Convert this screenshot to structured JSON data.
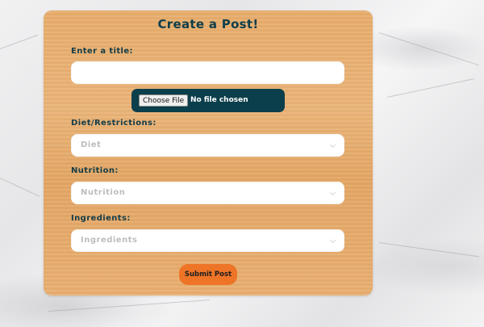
{
  "form": {
    "heading": "Create a Post!",
    "title_label": "Enter a title:",
    "title_value": "",
    "file_input": {
      "button_label": "Choose File",
      "status_text": "No file chosen"
    },
    "diet": {
      "label": "Diet/Restrictions:",
      "selected": "Diet"
    },
    "nutrition": {
      "label": "Nutrition:",
      "selected": "Nutrition"
    },
    "ingredients": {
      "label": "Ingredients:",
      "selected": "Ingredients"
    },
    "submit_label": "Submit Post"
  },
  "icons": {
    "dropdown": "chevron-down-icon"
  },
  "colors": {
    "heading": "#0e3f4b",
    "file_box": "#0b3f4b",
    "submit_button": "#ee7427",
    "card": "#e8ae6e"
  }
}
